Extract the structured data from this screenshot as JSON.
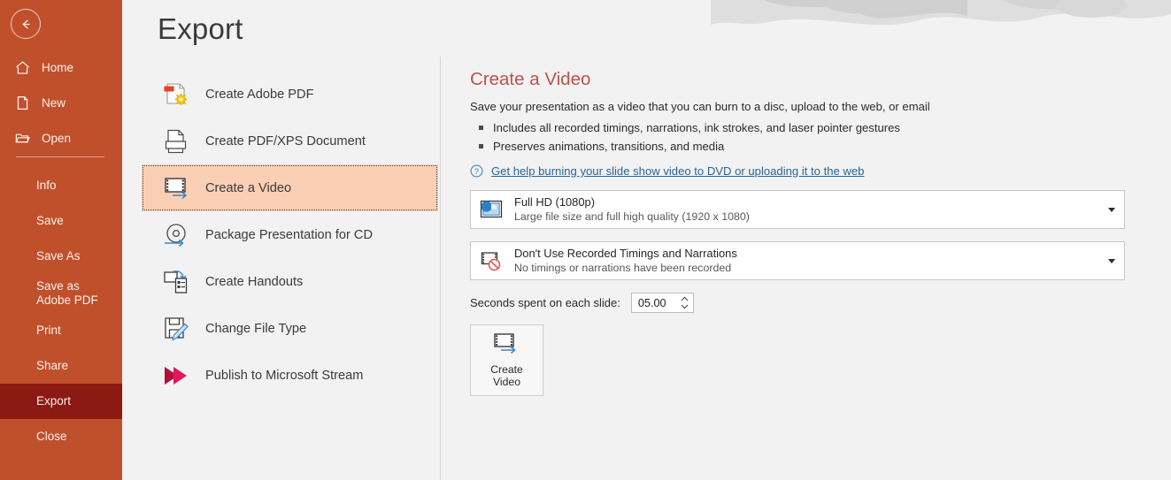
{
  "page": {
    "title": "Export"
  },
  "sidebar": {
    "bg_color": "#c0502c",
    "active_bg_color": "#8b1a13",
    "back_button": {
      "name": "back-button",
      "icon": "back-arrow-icon"
    },
    "top_items": [
      {
        "label": "Home",
        "icon": "home-icon"
      },
      {
        "label": "New",
        "icon": "new-document-icon"
      },
      {
        "label": "Open",
        "icon": "open-folder-icon"
      }
    ],
    "bottom_items": [
      {
        "label": "Info",
        "active": false
      },
      {
        "label": "Save",
        "active": false
      },
      {
        "label": "Save As",
        "active": false
      },
      {
        "label": "Save as Adobe PDF",
        "active": false
      },
      {
        "label": "Print",
        "active": false
      },
      {
        "label": "Share",
        "active": false
      },
      {
        "label": "Export",
        "active": true
      },
      {
        "label": "Close",
        "active": false
      }
    ]
  },
  "export_options": [
    {
      "label": "Create Adobe PDF",
      "icon": "adobe-pdf-icon",
      "selected": false
    },
    {
      "label": "Create PDF/XPS Document",
      "icon": "pdf-xps-icon",
      "selected": false
    },
    {
      "label": "Create a Video",
      "icon": "film-strip-icon",
      "selected": true
    },
    {
      "label": "Package Presentation for CD",
      "icon": "cd-disc-icon",
      "selected": false
    },
    {
      "label": "Create Handouts",
      "icon": "handouts-icon",
      "selected": false
    },
    {
      "label": "Change File Type",
      "icon": "change-file-type-icon",
      "selected": false
    },
    {
      "label": "Publish to Microsoft Stream",
      "icon": "stream-play-icon",
      "selected": false
    }
  ],
  "detail": {
    "heading": "Create a Video",
    "heading_color": "#c0504d",
    "description": "Save your presentation as a video that you can burn to a disc, upload to the web, or email",
    "bullets": [
      "Includes all recorded timings, narrations, ink strokes, and laser pointer gestures",
      "Preserves animations, transitions, and media"
    ],
    "help_link": "Get help burning your slide show video to DVD or uploading it to the web",
    "help_link_color": "#2a6496",
    "quality_dropdown": {
      "title": "Full HD (1080p)",
      "subtitle": "Large file size and full high quality (1920 x 1080)",
      "icon": "video-quality-icon"
    },
    "timings_dropdown": {
      "title": "Don't Use Recorded Timings and Narrations",
      "subtitle": "No timings or narrations have been recorded",
      "icon": "no-timings-icon"
    },
    "seconds_label": "Seconds spent on each slide:",
    "seconds_value": "05.00",
    "create_video_button": {
      "line1": "Create",
      "line2": "Video",
      "icon": "film-strip-icon"
    }
  }
}
